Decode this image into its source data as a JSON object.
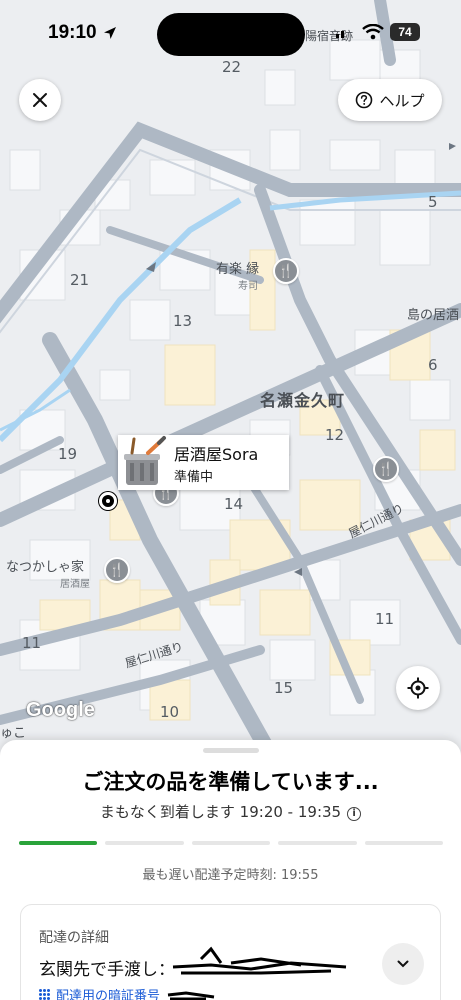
{
  "status_bar": {
    "time": "19:10",
    "battery": "74"
  },
  "map": {
    "block_numbers": [
      "22",
      "21",
      "13",
      "19",
      "14",
      "12",
      "5",
      "6",
      "11",
      "11",
      "15",
      "10"
    ],
    "area_name": "名瀬金久町",
    "streets": [
      "屋仁川通り",
      "屋仁川通り"
    ],
    "top_label": "陽宿音跡",
    "right_label": "島の居酒",
    "bottom_left_label": "ゅこ",
    "pois": [
      {
        "name": "有楽 縁",
        "sub": "寿司"
      },
      {
        "name": "なつかしゃ家",
        "sub": "居酒屋"
      }
    ],
    "attribution": "Google"
  },
  "header": {
    "help_label": "ヘルプ"
  },
  "restaurant": {
    "name": "居酒屋Sora",
    "status": "準備中"
  },
  "order": {
    "title": "ご注文の品を準備しています...",
    "eta": "まもなく到着します 19:20 - 19:35",
    "progress_steps": 5,
    "progress_active": 1,
    "latest_time": "最も遅い配達予定時刻: 19:55",
    "details": {
      "label": "配達の詳細",
      "handoff": "玄関先で手渡し：",
      "pin_label": "配達用の暗証番号"
    }
  },
  "colors": {
    "accent_green": "#2aa33a",
    "link_blue": "#1a5bd6"
  }
}
